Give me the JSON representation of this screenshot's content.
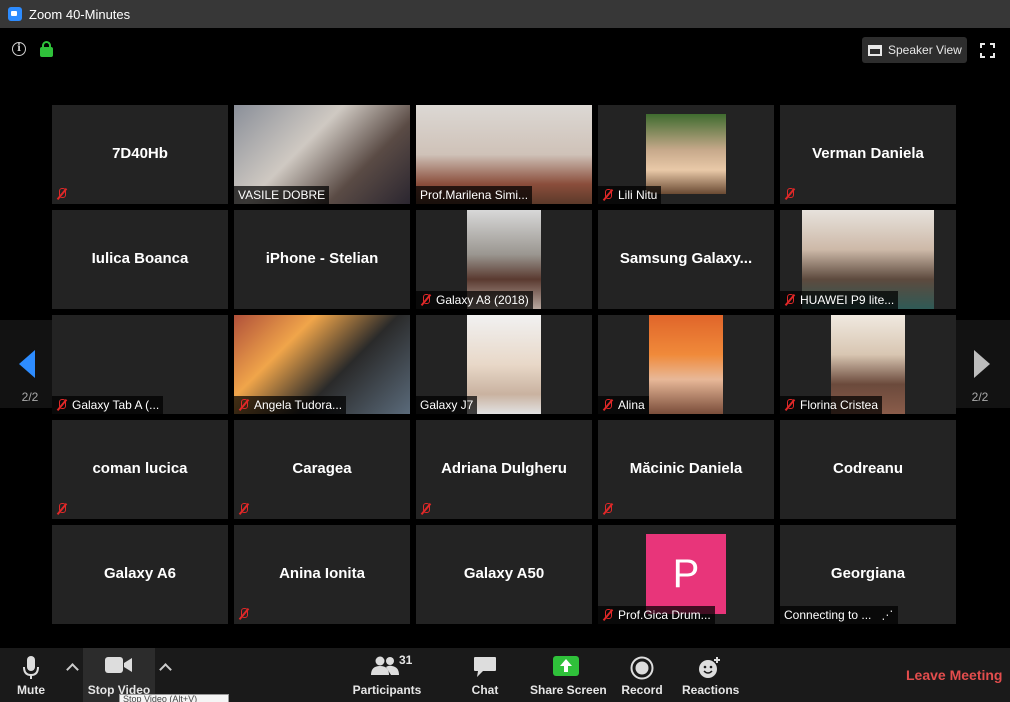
{
  "window": {
    "title": "Zoom 40-Minutes"
  },
  "header": {
    "speaker_view_label": "Speaker View"
  },
  "paging": {
    "left": "2/2",
    "right": "2/2"
  },
  "tiles": [
    {
      "name": "7D40Hb",
      "label": "",
      "muted": true,
      "video": false
    },
    {
      "name": "",
      "label": "VASILE DOBRE",
      "muted": false,
      "video": true
    },
    {
      "name": "",
      "label": "Prof.Marilena Simi...",
      "muted": false,
      "video": true
    },
    {
      "name": "",
      "label": "Lili Nitu",
      "muted": true,
      "video": true
    },
    {
      "name": "Verman Daniela",
      "label": "",
      "muted": true,
      "video": false
    },
    {
      "name": "Iulica Boanca",
      "label": "",
      "muted": false,
      "video": false
    },
    {
      "name": "iPhone - Stelian",
      "label": "",
      "muted": false,
      "video": false
    },
    {
      "name": "",
      "label": "Galaxy A8 (2018)",
      "muted": true,
      "video": true
    },
    {
      "name": "Samsung  Galaxy...",
      "label": "",
      "muted": false,
      "video": false
    },
    {
      "name": "",
      "label": "HUAWEI P9 lite...",
      "muted": true,
      "video": true
    },
    {
      "name": "",
      "label": "Galaxy Tab A (...",
      "muted": true,
      "video": false
    },
    {
      "name": "",
      "label": "Angela Tudora...",
      "muted": true,
      "video": true
    },
    {
      "name": "",
      "label": "Galaxy J7",
      "muted": false,
      "video": true
    },
    {
      "name": "",
      "label": "Alina",
      "muted": true,
      "video": true
    },
    {
      "name": "",
      "label": "Florina Cristea",
      "muted": true,
      "video": true
    },
    {
      "name": "coman lucica",
      "label": "",
      "muted": true,
      "video": false
    },
    {
      "name": "Caragea",
      "label": "",
      "muted": true,
      "video": false
    },
    {
      "name": "Adriana Dulgheru",
      "label": "",
      "muted": true,
      "video": false
    },
    {
      "name": "Măcinic Daniela",
      "label": "",
      "muted": true,
      "video": false
    },
    {
      "name": "Codreanu",
      "label": "",
      "muted": false,
      "video": false
    },
    {
      "name": "Galaxy A6",
      "label": "",
      "muted": false,
      "video": false
    },
    {
      "name": "Anina Ionita",
      "label": "",
      "muted": true,
      "video": false
    },
    {
      "name": "Galaxy A50",
      "label": "",
      "muted": false,
      "video": false
    },
    {
      "name": "",
      "label": "Prof.Gica Drum...",
      "muted": true,
      "video": false,
      "avatar_letter": "P"
    },
    {
      "name": "Georgiana",
      "label": "Connecting to ...",
      "muted": false,
      "video": false
    }
  ],
  "avatar_color": "#e8357a",
  "toolbar": {
    "mute": "Mute",
    "stop_video": "Stop Video",
    "participants": "Participants",
    "participants_count": "31",
    "chat": "Chat",
    "share_screen": "Share Screen",
    "record": "Record",
    "reactions": "Reactions",
    "leave": "Leave Meeting",
    "tooltip": "Stop Video (Alt+V)"
  },
  "colors": {
    "accent": "#2d8cff",
    "share": "#2fc13a",
    "leave": "#e34d4d",
    "muted": "#e02828"
  }
}
